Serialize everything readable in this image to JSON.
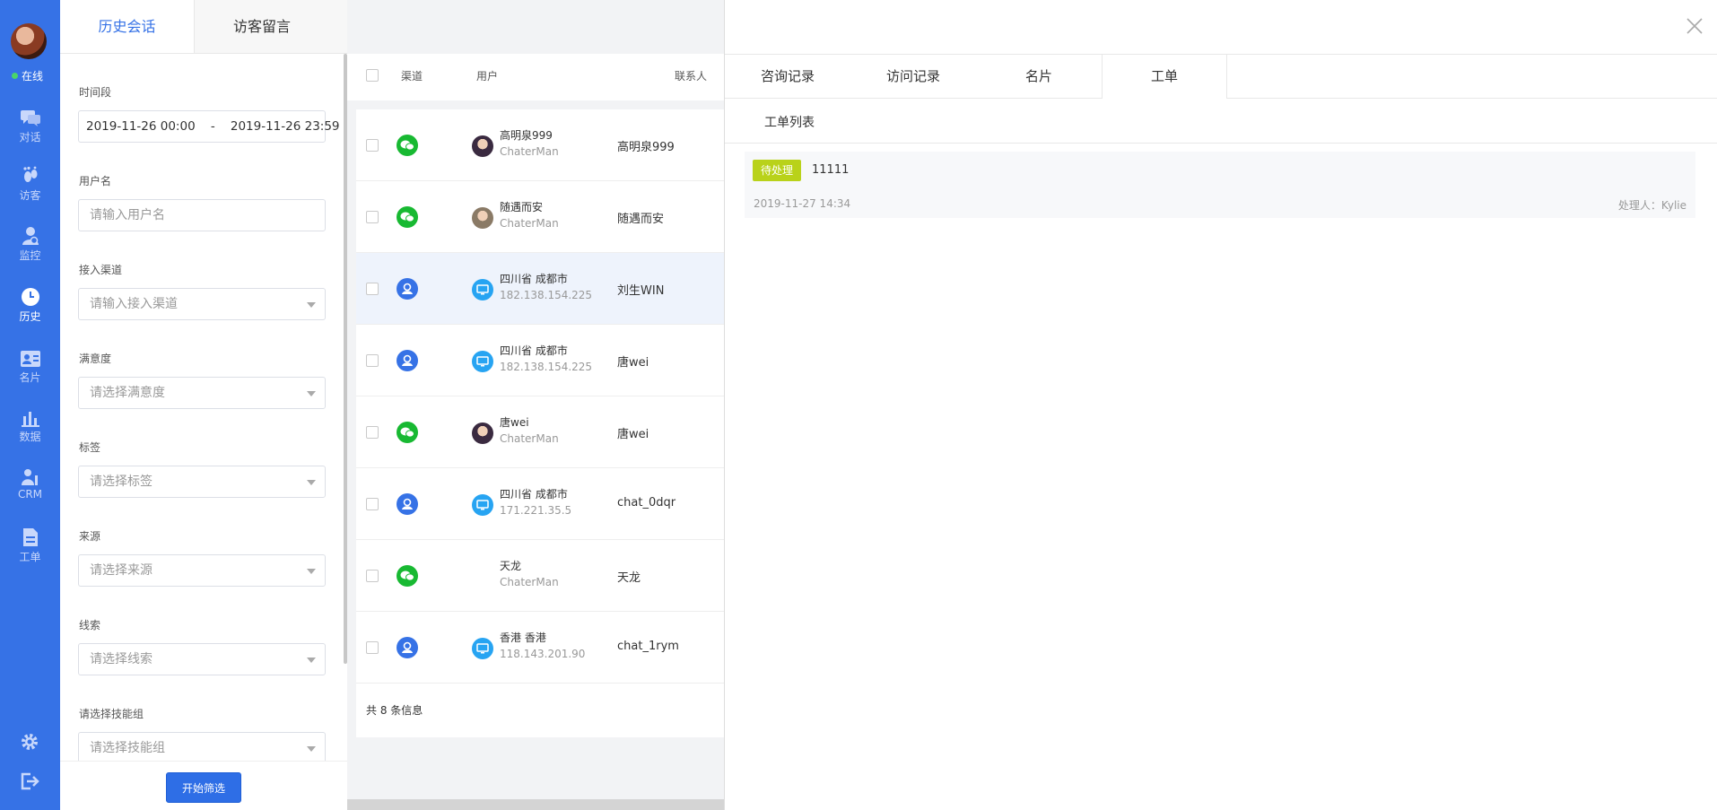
{
  "nav": {
    "status": "在线",
    "items": [
      {
        "label": "对话",
        "icon": "chat-icon"
      },
      {
        "label": "访客",
        "icon": "footprint-icon"
      },
      {
        "label": "监控",
        "icon": "monitor-icon"
      },
      {
        "label": "历史",
        "icon": "clock-icon"
      },
      {
        "label": "名片",
        "icon": "card-icon"
      },
      {
        "label": "数据",
        "icon": "bar-chart-icon"
      },
      {
        "label": "CRM",
        "icon": "crm-icon"
      },
      {
        "label": "工单",
        "icon": "ticket-icon"
      }
    ],
    "bottom_icons": [
      "settings-icon",
      "logout-icon"
    ]
  },
  "filter": {
    "tabs": [
      "历史会话",
      "访客留言"
    ],
    "date_range": "2019-11-26 00:00    -    2019-11-26 23:59",
    "fields": [
      {
        "label": "时间段"
      },
      {
        "label": "用户名",
        "placeholder": "请输入用户名"
      },
      {
        "label": "接入渠道",
        "placeholder": "请输入接入渠道"
      },
      {
        "label": "满意度",
        "placeholder": "请选择满意度"
      },
      {
        "label": "标签",
        "placeholder": "请选择标签"
      },
      {
        "label": "来源",
        "placeholder": "请选择来源"
      },
      {
        "label": "线索",
        "placeholder": "请选择线索"
      },
      {
        "label": "请选择技能组",
        "placeholder": "请选择技能组"
      }
    ],
    "submit": "开始筛选"
  },
  "table": {
    "headers": {
      "channel": "渠道",
      "user": "用户",
      "contact": "联系人"
    },
    "rows": [
      {
        "channel": "wechat",
        "avatar": "photo",
        "name": "高明泉999",
        "sub": "ChaterMan",
        "contact": "高明泉999"
      },
      {
        "channel": "wechat",
        "avatar": "photo",
        "name": "随遇而安",
        "sub": "ChaterMan",
        "contact": "随遇而安"
      },
      {
        "channel": "web",
        "avatar": "pc",
        "name": "四川省 成都市",
        "sub": "182.138.154.225",
        "contact": "刘生WIN"
      },
      {
        "channel": "web",
        "avatar": "pc",
        "name": "四川省 成都市",
        "sub": "182.138.154.225",
        "contact": "唐wei"
      },
      {
        "channel": "wechat",
        "avatar": "photo",
        "name": "唐wei",
        "sub": "ChaterMan",
        "contact": "唐wei"
      },
      {
        "channel": "web",
        "avatar": "pc",
        "name": "四川省 成都市",
        "sub": "171.221.35.5",
        "contact": "chat_0dqr"
      },
      {
        "channel": "wechat",
        "avatar": "none",
        "name": "天龙",
        "sub": "ChaterMan",
        "contact": "天龙"
      },
      {
        "channel": "web",
        "avatar": "pc",
        "name": "香港 香港",
        "sub": "118.143.201.90",
        "contact": "chat_1rym"
      }
    ],
    "total": "共 8 条信息"
  },
  "drawer": {
    "tabs": [
      "咨询记录",
      "访问记录",
      "名片",
      "工单"
    ],
    "active_tab": "工单",
    "sub_title": "工单列表",
    "ticket": {
      "status": "待处理",
      "title": "11111",
      "time": "2019-11-27 14:34",
      "handler": "处理人：Kylie"
    }
  },
  "colors": {
    "brand": "#3672e6",
    "wechat": "#18b932",
    "pending": "#b9d21a"
  }
}
